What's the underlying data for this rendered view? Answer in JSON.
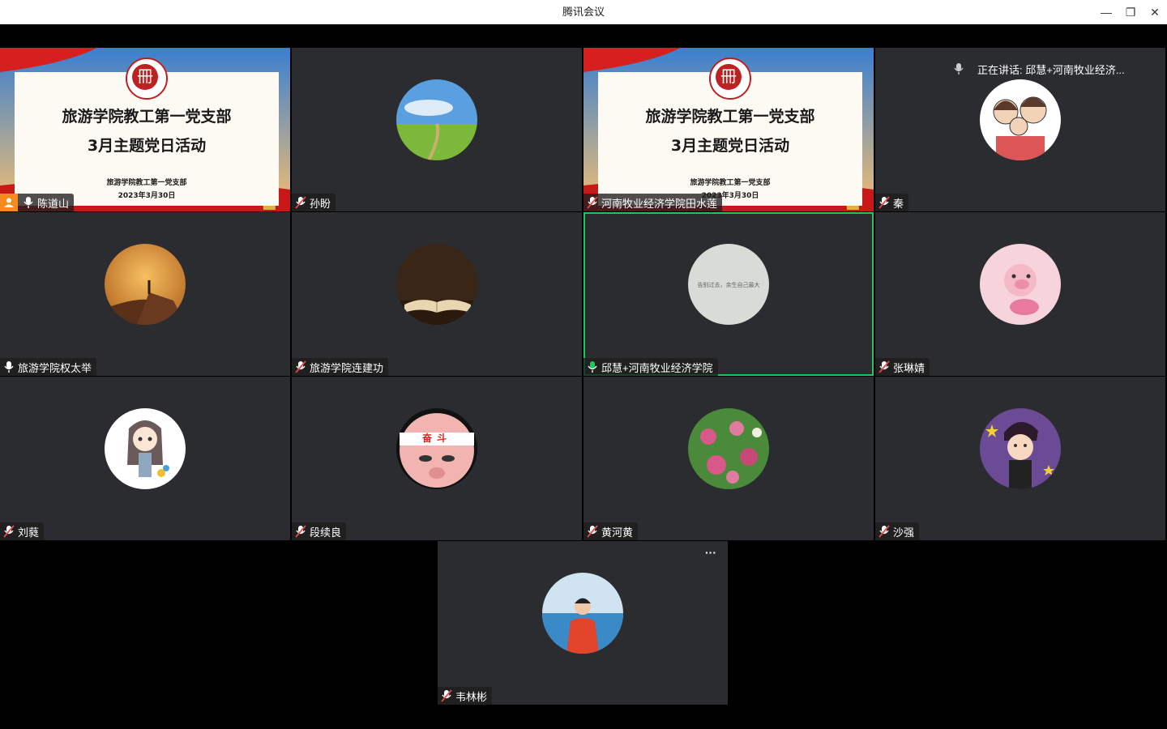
{
  "window": {
    "title": "腾讯会议",
    "minimize_glyph": "—",
    "restore_glyph": "❐",
    "close_glyph": "✕"
  },
  "speaking_indicator": {
    "text": "正在讲话: 邱慧+河南牧业经济...",
    "icon": "mic-icon"
  },
  "slide": {
    "title_line1": "旅游学院教工第一党支部",
    "title_line2": "3月主题党日活动",
    "org": "旅游学院教工第一党支部",
    "date": "2023年3月30日"
  },
  "participants": [
    {
      "name": "陈道山",
      "mic": "on",
      "host": true,
      "view": "slide"
    },
    {
      "name": "孙盼",
      "mic": "muted",
      "avatar": "landscape-avatar"
    },
    {
      "name": "河南牧业经济学院田水莲",
      "mic": "muted",
      "view": "slide"
    },
    {
      "name": "秦",
      "mic": "muted",
      "avatar": "family-cartoon-avatar"
    },
    {
      "name": "旅游学院权太举",
      "mic": "on",
      "avatar": "sunset-hiker-avatar"
    },
    {
      "name": "旅游学院连建功",
      "mic": "muted",
      "avatar": "open-book-avatar"
    },
    {
      "name": "邱慧+河南牧业经济学院",
      "mic": "speaking",
      "avatar": "quote-avatar",
      "avatar_text": "告别过去，余生自己最大"
    },
    {
      "name": "张琳婧",
      "mic": "muted",
      "avatar": "pig-avatar"
    },
    {
      "name": "刘蕤",
      "mic": "muted",
      "avatar": "cartoon-girl-avatar"
    },
    {
      "name": "段续良",
      "mic": "muted",
      "avatar": "fendou-face-avatar",
      "avatar_text": "奋斗"
    },
    {
      "name": "黄河黄",
      "mic": "muted",
      "avatar": "flowers-avatar"
    },
    {
      "name": "沙强",
      "mic": "muted",
      "avatar": "cartoon-man-avatar"
    },
    {
      "name": "韦林彬",
      "mic": "muted",
      "avatar": "woman-photo-avatar",
      "more": "···"
    }
  ],
  "colors": {
    "tile_bg": "#2a2c30",
    "active_border": "#1fc65a",
    "speaking_mic": "#1fc65a",
    "muted_mic": "#e04a4a"
  }
}
